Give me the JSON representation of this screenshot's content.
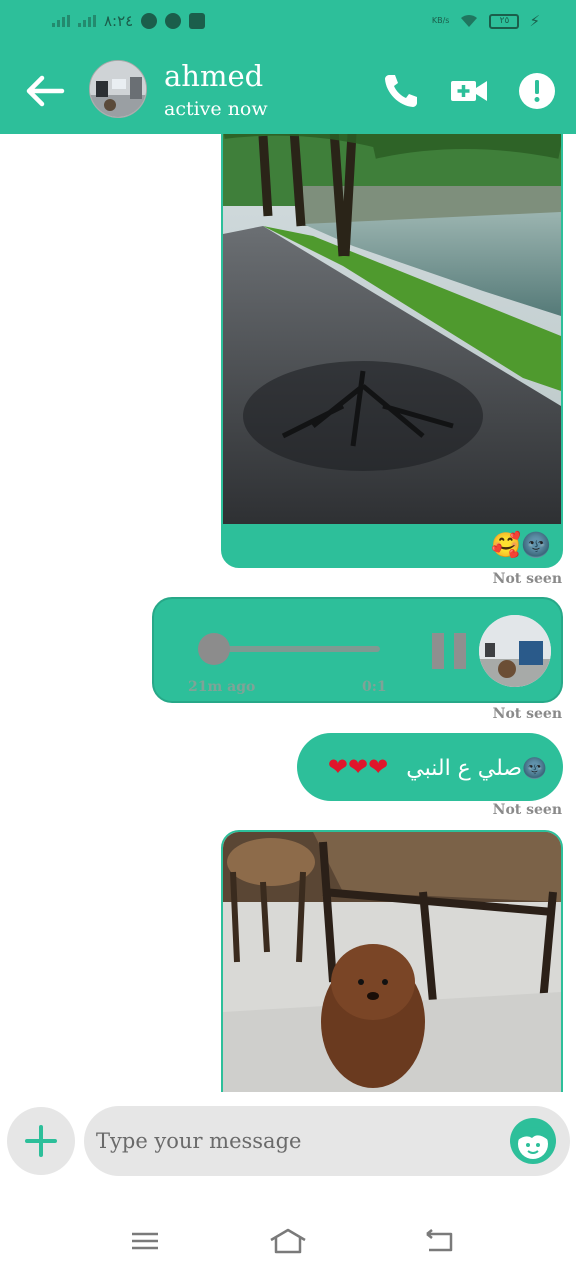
{
  "status_bar": {
    "time": "٨:٢٤",
    "network_speed": "KB/s",
    "battery": "٢٥"
  },
  "header": {
    "contact_name": "ahmed",
    "contact_status": "active now",
    "icons": [
      "back-arrow-icon",
      "phone-icon",
      "video-camera-icon",
      "info-icon"
    ]
  },
  "messages": [
    {
      "type": "image",
      "reactions": "🥰🌚",
      "status": "Not seen"
    },
    {
      "type": "voice",
      "time_ago": "21m ago",
      "duration": "0:1",
      "progress": 0.0,
      "status": "Not seen"
    },
    {
      "type": "text",
      "text": "صلي ع النبي",
      "emoji_prefix": "🌚",
      "hearts": "❤❤❤",
      "status": "Not seen"
    },
    {
      "type": "image"
    }
  ],
  "composer": {
    "placeholder": "Type your message"
  },
  "colors": {
    "accent": "#2dbf9a",
    "seen_text": "#8a8a8a",
    "input_bg": "#e6e6e6"
  }
}
